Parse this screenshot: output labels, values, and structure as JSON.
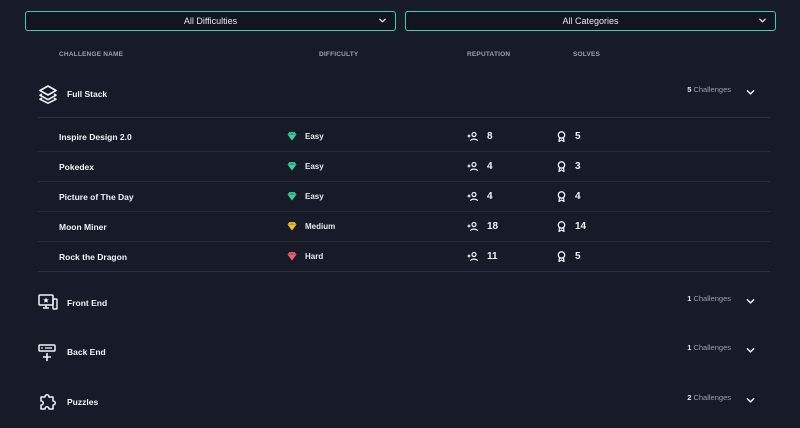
{
  "filters": {
    "difficulty_selected": "All Difficulties",
    "category_selected": "All Categories"
  },
  "columns": {
    "name": "CHALLENGE NAME",
    "difficulty": "DIFFICULTY",
    "reputation": "REPUTATION",
    "solves": "SOLVES"
  },
  "categories": [
    {
      "name": "Full Stack",
      "icon": "layers-icon",
      "count": "5",
      "count_label": "Challenges",
      "expanded": true,
      "challenges": [
        {
          "name": "Inspire Design 2.0",
          "difficulty": "Easy",
          "reputation": "8",
          "solves": "5"
        },
        {
          "name": "Pokedex",
          "difficulty": "Easy",
          "reputation": "4",
          "solves": "3"
        },
        {
          "name": "Picture of The Day",
          "difficulty": "Easy",
          "reputation": "4",
          "solves": "4"
        },
        {
          "name": "Moon Miner",
          "difficulty": "Medium",
          "reputation": "18",
          "solves": "14"
        },
        {
          "name": "Rock the Dragon",
          "difficulty": "Hard",
          "reputation": "11",
          "solves": "5"
        }
      ]
    },
    {
      "name": "Front End",
      "icon": "monitor-star-icon",
      "count": "1",
      "count_label": "Challenges",
      "expanded": false
    },
    {
      "name": "Back End",
      "icon": "server-add-icon",
      "count": "1",
      "count_label": "Challenges",
      "expanded": false
    },
    {
      "name": "Puzzles",
      "icon": "puzzle-icon",
      "count": "2",
      "count_label": "Challenges",
      "expanded": false
    }
  ],
  "colors": {
    "background": "#161b27",
    "accent_border": "#2fd5a8",
    "easy": "#36d39a",
    "medium": "#f2c12e",
    "hard": "#f0616d"
  }
}
